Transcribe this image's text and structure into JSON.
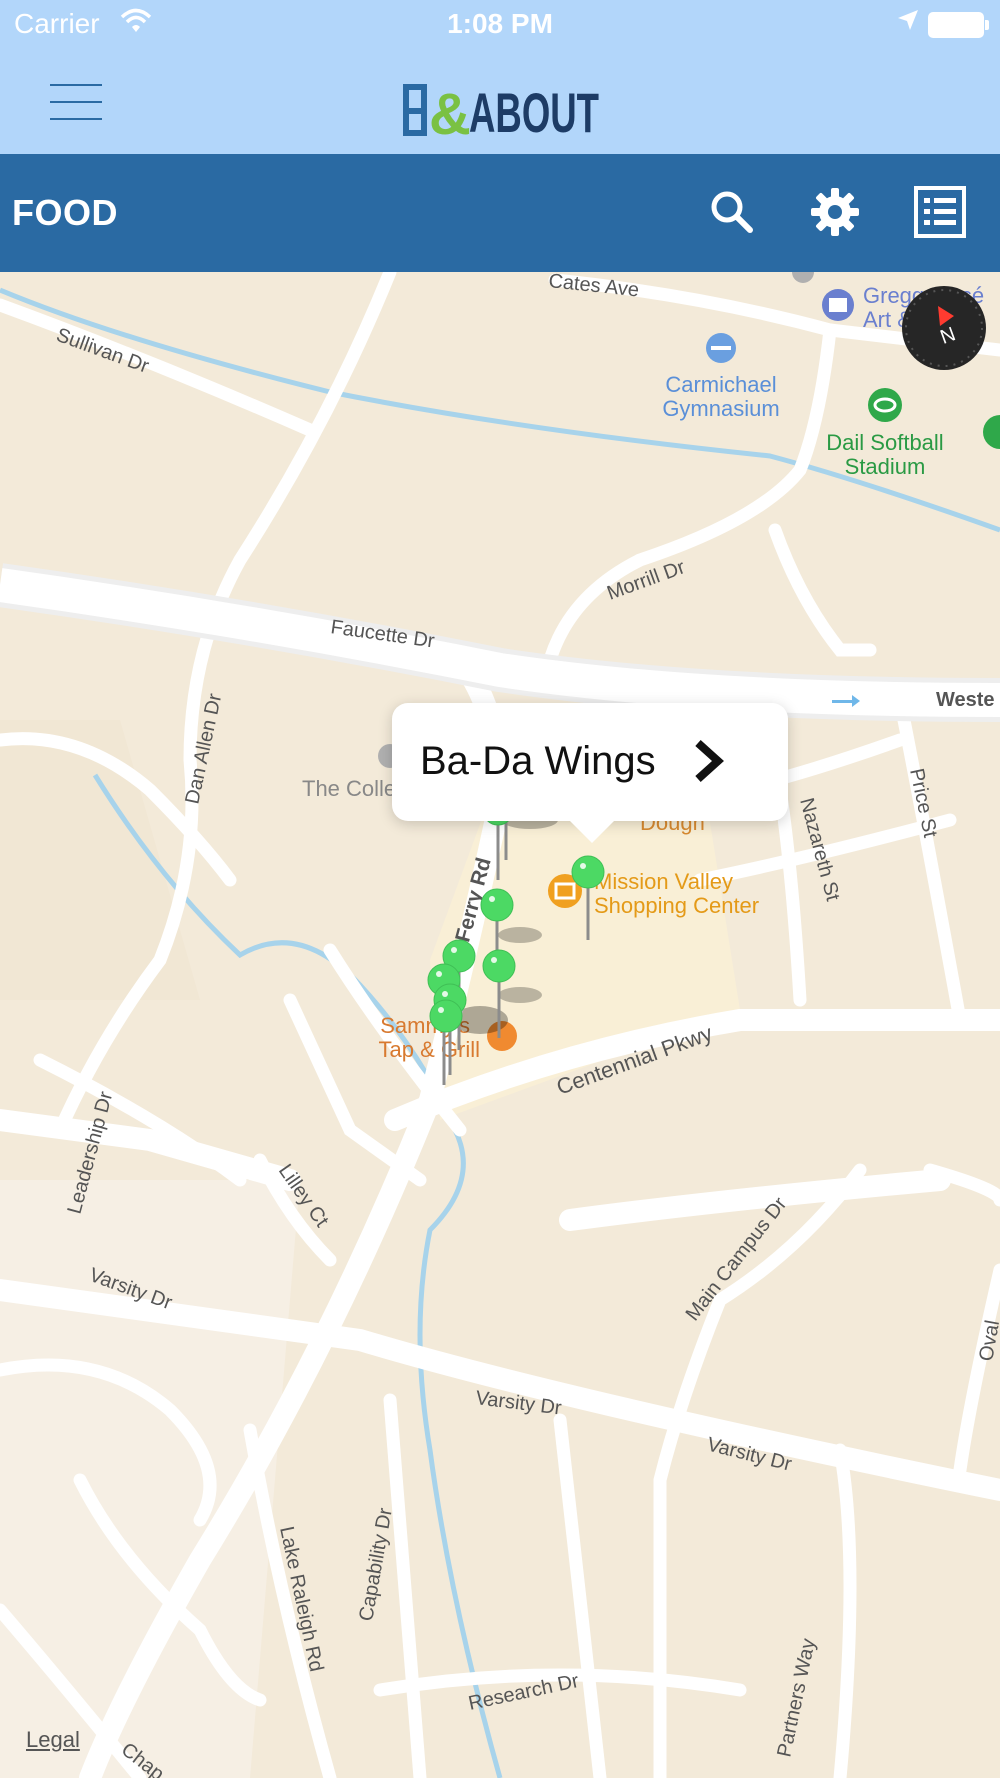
{
  "status_bar": {
    "carrier": "Carrier",
    "time": "1:08 PM"
  },
  "header": {
    "logo_alt": "OUT&ABOUT"
  },
  "toolbar": {
    "title": "FOOD",
    "search_icon": "search-icon",
    "settings_icon": "gear-icon",
    "list_icon": "list-icon"
  },
  "callout": {
    "name": "Ba-Da Wings"
  },
  "map": {
    "streets": {
      "cates": "Cates Ave",
      "sullivan": "Sullivan Dr",
      "morrill": "Morrill Dr",
      "faucette": "Faucette Dr",
      "dan_allen": "Dan Allen Dr",
      "weste": "Weste",
      "price": "Price St",
      "nazareth": "Nazareth St",
      "centennial": "Centennial Pkwy",
      "ferry": "nt Ferry Rd",
      "leadership": "Leadership Dr",
      "lilley": "Lilley Ct",
      "varsity1": "Varsity Dr",
      "varsity2": "Varsity Dr",
      "varsity3": "Varsity Dr",
      "main_campus": "Main Campus Dr",
      "oval": "Oval",
      "lake_raleigh": "Lake Raleigh Rd",
      "capability": "Capability Dr",
      "research": "Research Dr",
      "partners": "Partners Way",
      "chap": "Chap"
    },
    "pois": {
      "gymnasium_1": "Carmichael",
      "gymnasium_2": "Gymnasium",
      "softball_1": "Dail Softball",
      "softball_2": "Stadium",
      "museum_1": "Gregg Musé",
      "museum_2": "Art & Desig",
      "college_inn": "The College Inn",
      "dough": "Dough",
      "mission_1": "Mission Valley",
      "mission_2": "Shopping Center",
      "sammys_1": "Sammy's",
      "sammys_2": "Tap & Grill"
    },
    "compass_letter": "N",
    "legal": "Legal"
  },
  "colors": {
    "header_light": "#b2d6fa",
    "toolbar": "#2a6aa3",
    "pin": "#4cd964",
    "poi_orange": "#f0a020",
    "poi_blue": "#6a9fe0",
    "poi_green": "#2fa84a"
  }
}
